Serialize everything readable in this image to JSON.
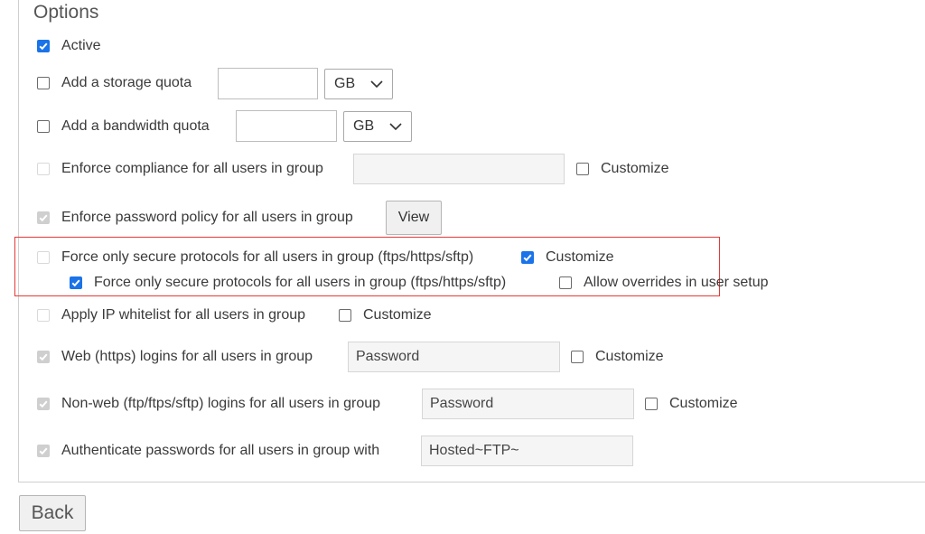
{
  "options": {
    "title": "Options",
    "active_label": "Active",
    "storage_quota_label": "Add a storage quota",
    "storage_quota_value": "",
    "storage_unit": "GB",
    "bandwidth_quota_label": "Add a bandwidth quota",
    "bandwidth_quota_value": "",
    "bandwidth_unit": "GB",
    "compliance_label": "Enforce compliance for all users in group",
    "compliance_value": "",
    "customize_label": "Customize",
    "password_policy_label": "Enforce password policy for all users in group",
    "view_label": "View",
    "secure_protocols_label": "Force only secure protocols for all users in group (ftps/https/sftp)",
    "secure_protocols_sub_label": "Force only secure protocols for all users in group (ftps/https/sftp)",
    "allow_overrides_label": "Allow overrides in user setup",
    "ip_whitelist_label": "Apply IP whitelist for all users in group",
    "web_logins_label": "Web (https) logins for all users in group",
    "web_logins_value": "Password",
    "nonweb_logins_label": "Non-web (ftp/ftps/sftp) logins for all users in group",
    "nonweb_logins_value": "Password",
    "authenticate_label": "Authenticate passwords for all users in group with",
    "authenticate_value": "Hosted~FTP~"
  },
  "footer": {
    "back_label": "Back"
  },
  "colors": {
    "accent": "#1a73e8",
    "highlight_border": "#e53935"
  }
}
